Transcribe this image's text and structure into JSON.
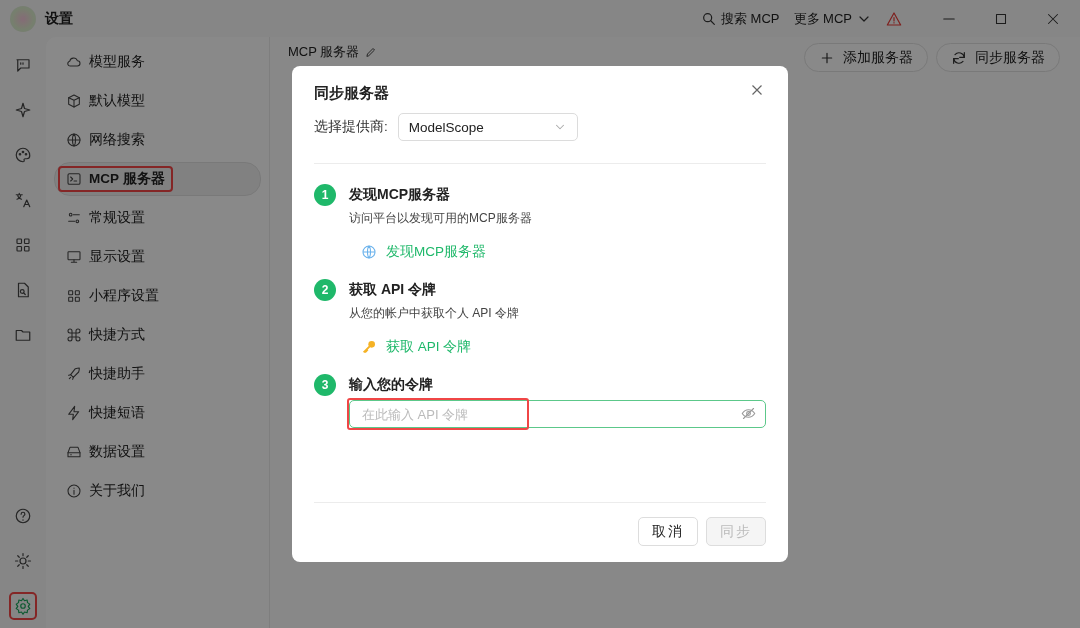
{
  "window": {
    "title": "设置"
  },
  "titlebar": {
    "search_label": "搜索 MCP",
    "more_label": "更多 MCP"
  },
  "rail": {
    "top": [
      {
        "kind": "chat",
        "selected": false
      },
      {
        "kind": "sparkle",
        "selected": false
      },
      {
        "kind": "palette",
        "selected": false
      },
      {
        "kind": "translate",
        "selected": false
      },
      {
        "kind": "grid",
        "selected": false
      },
      {
        "kind": "file",
        "selected": false
      },
      {
        "kind": "folder",
        "selected": false
      }
    ],
    "bottom": [
      {
        "kind": "help",
        "selected": false,
        "highlighted": false
      },
      {
        "kind": "theme",
        "selected": false,
        "highlighted": false
      },
      {
        "kind": "settings",
        "selected": true,
        "highlighted": true
      }
    ]
  },
  "nav": {
    "items": [
      {
        "label": "模型服务",
        "kind": "cloud",
        "selected": false,
        "highlighted": false
      },
      {
        "label": "默认模型",
        "kind": "cube",
        "selected": false,
        "highlighted": false
      },
      {
        "label": "网络搜索",
        "kind": "globe",
        "selected": false,
        "highlighted": false
      },
      {
        "label": "MCP 服务器",
        "kind": "terminal",
        "selected": true,
        "highlighted": true
      },
      {
        "label": "常规设置",
        "kind": "sliders",
        "selected": false,
        "highlighted": false
      },
      {
        "label": "显示设置",
        "kind": "monitor",
        "selected": false,
        "highlighted": false
      },
      {
        "label": "小程序设置",
        "kind": "grid",
        "selected": false,
        "highlighted": false
      },
      {
        "label": "快捷方式",
        "kind": "command",
        "selected": false,
        "highlighted": false
      },
      {
        "label": "快捷助手",
        "kind": "rocket",
        "selected": false,
        "highlighted": false
      },
      {
        "label": "快捷短语",
        "kind": "bolt",
        "selected": false,
        "highlighted": false
      },
      {
        "label": "数据设置",
        "kind": "drive",
        "selected": false,
        "highlighted": false
      },
      {
        "label": "关于我们",
        "kind": "info",
        "selected": false,
        "highlighted": false
      }
    ]
  },
  "page": {
    "title": "MCP 服务器",
    "buttons": [
      {
        "label": "添加服务器",
        "kind": "add"
      },
      {
        "label": "同步服务器",
        "kind": "sync"
      }
    ]
  },
  "dialog": {
    "title": "同步服务器",
    "provider_label": "选择提供商:",
    "provider_value": "ModelScope",
    "steps": [
      {
        "number": "1",
        "title": "发现MCP服务器",
        "description": "访问平台以发现可用的MCP服务器",
        "kind": "link",
        "link": {
          "label": "发现MCP服务器"
        }
      },
      {
        "number": "2",
        "title": "获取 API 令牌",
        "description": "从您的帐户中获取个人 API 令牌",
        "kind": "link",
        "link": {
          "label": "获取 API 令牌"
        }
      },
      {
        "number": "3",
        "title": "输入您的令牌",
        "kind": "field",
        "field": {
          "placeholder": "在此输入 API 令牌",
          "highlighted": true
        }
      }
    ],
    "buttons": [
      {
        "label": "取消",
        "disabled": false
      },
      {
        "label": "同步",
        "disabled": true
      }
    ]
  }
}
